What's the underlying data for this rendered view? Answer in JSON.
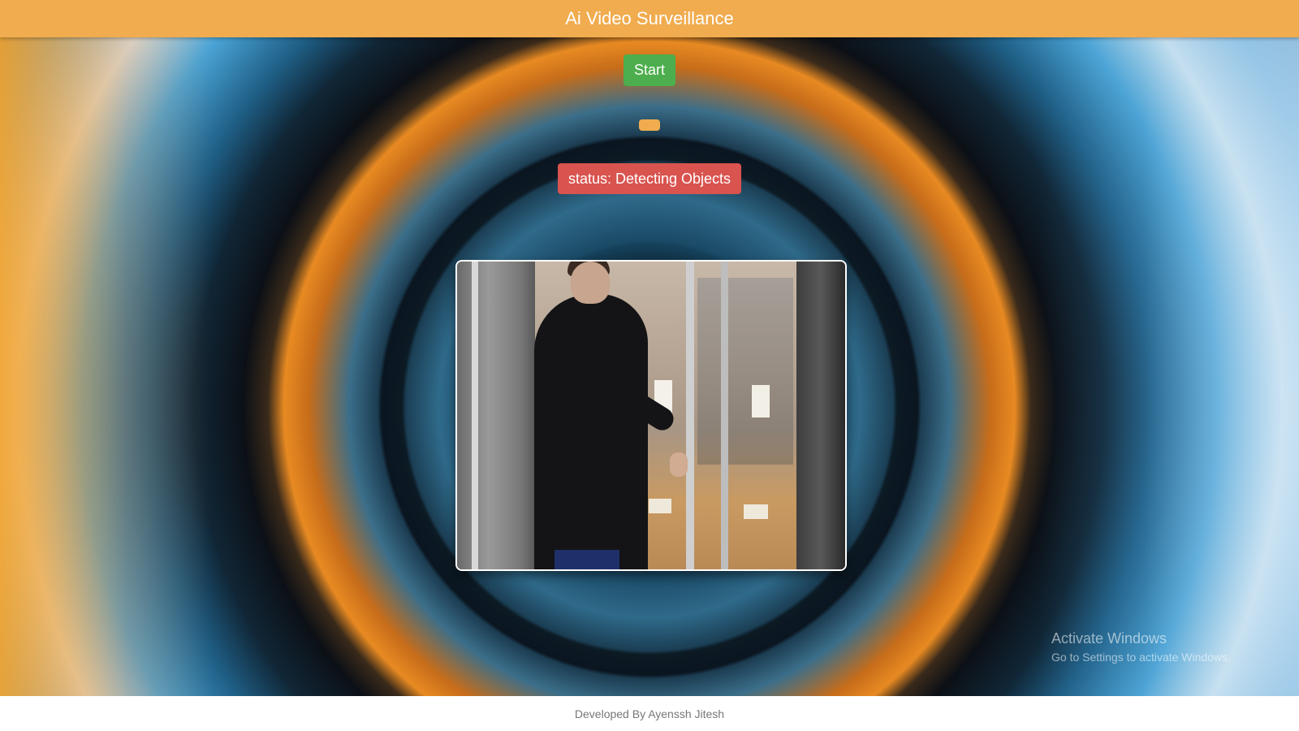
{
  "header": {
    "title": "Ai Video Surveillance"
  },
  "controls": {
    "start_label": "Start"
  },
  "status": {
    "text": "status: Detecting Objects"
  },
  "watermark": {
    "title": "Activate Windows",
    "subtitle": "Go to Settings to activate Windows."
  },
  "footer": {
    "credit": "Developed By Ayenssh Jitesh"
  },
  "colors": {
    "header_bg": "#f0ac4e",
    "start_button": "#4cae4c",
    "status_badge": "#d9534f",
    "indicator": "#f0ac4e"
  }
}
